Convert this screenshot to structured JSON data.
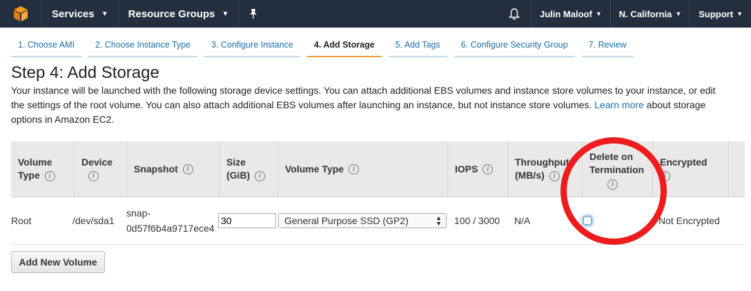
{
  "nav": {
    "services": "Services",
    "resource_groups": "Resource Groups",
    "user": "Julin Maloof",
    "region": "N. California",
    "support": "Support",
    "bg_color": "#232f3e",
    "logo_color": "#f7981d"
  },
  "wizard": {
    "tabs": [
      {
        "label": "1. Choose AMI"
      },
      {
        "label": "2. Choose Instance Type"
      },
      {
        "label": "3. Configure Instance"
      },
      {
        "label": "4. Add Storage"
      },
      {
        "label": "5. Add Tags"
      },
      {
        "label": "6. Configure Security Group"
      },
      {
        "label": "7. Review"
      }
    ]
  },
  "page": {
    "title": "Step 4: Add Storage",
    "description": "Your instance will be launched with the following storage device settings. You can attach additional EBS volumes and instance store volumes to your instance, or edit the settings of the root volume. You can also attach additional EBS volumes after launching an instance, but not instance store volumes.",
    "learn_more": "Learn more",
    "description_tail": " about storage options in Amazon EC2."
  },
  "table": {
    "headers": {
      "volume_type_1": "Volume",
      "volume_type_2": "Type",
      "device": "Device",
      "snapshot": "Snapshot",
      "size_1": "Size",
      "size_2": "(GiB)",
      "vol_type": "Volume Type",
      "iops": "IOPS",
      "throughput_1": "Throughput",
      "throughput_2": "(MB/s)",
      "delete_1": "Delete on",
      "delete_2": "Termination",
      "encrypted": "Encrypted"
    },
    "row": {
      "volume_type": "Root",
      "device": "/dev/sda1",
      "snapshot_1": "snap-",
      "snapshot_2": "0d57f6b4a9717ece4",
      "size": "30",
      "volume_type_select": "General Purpose SSD (GP2)",
      "iops": "100 / 3000",
      "throughput": "N/A",
      "delete_on_termination": false,
      "encrypted": "Not Encrypted"
    }
  },
  "buttons": {
    "add_volume": "Add New Volume"
  },
  "annotation_color": "#ee1c1c"
}
